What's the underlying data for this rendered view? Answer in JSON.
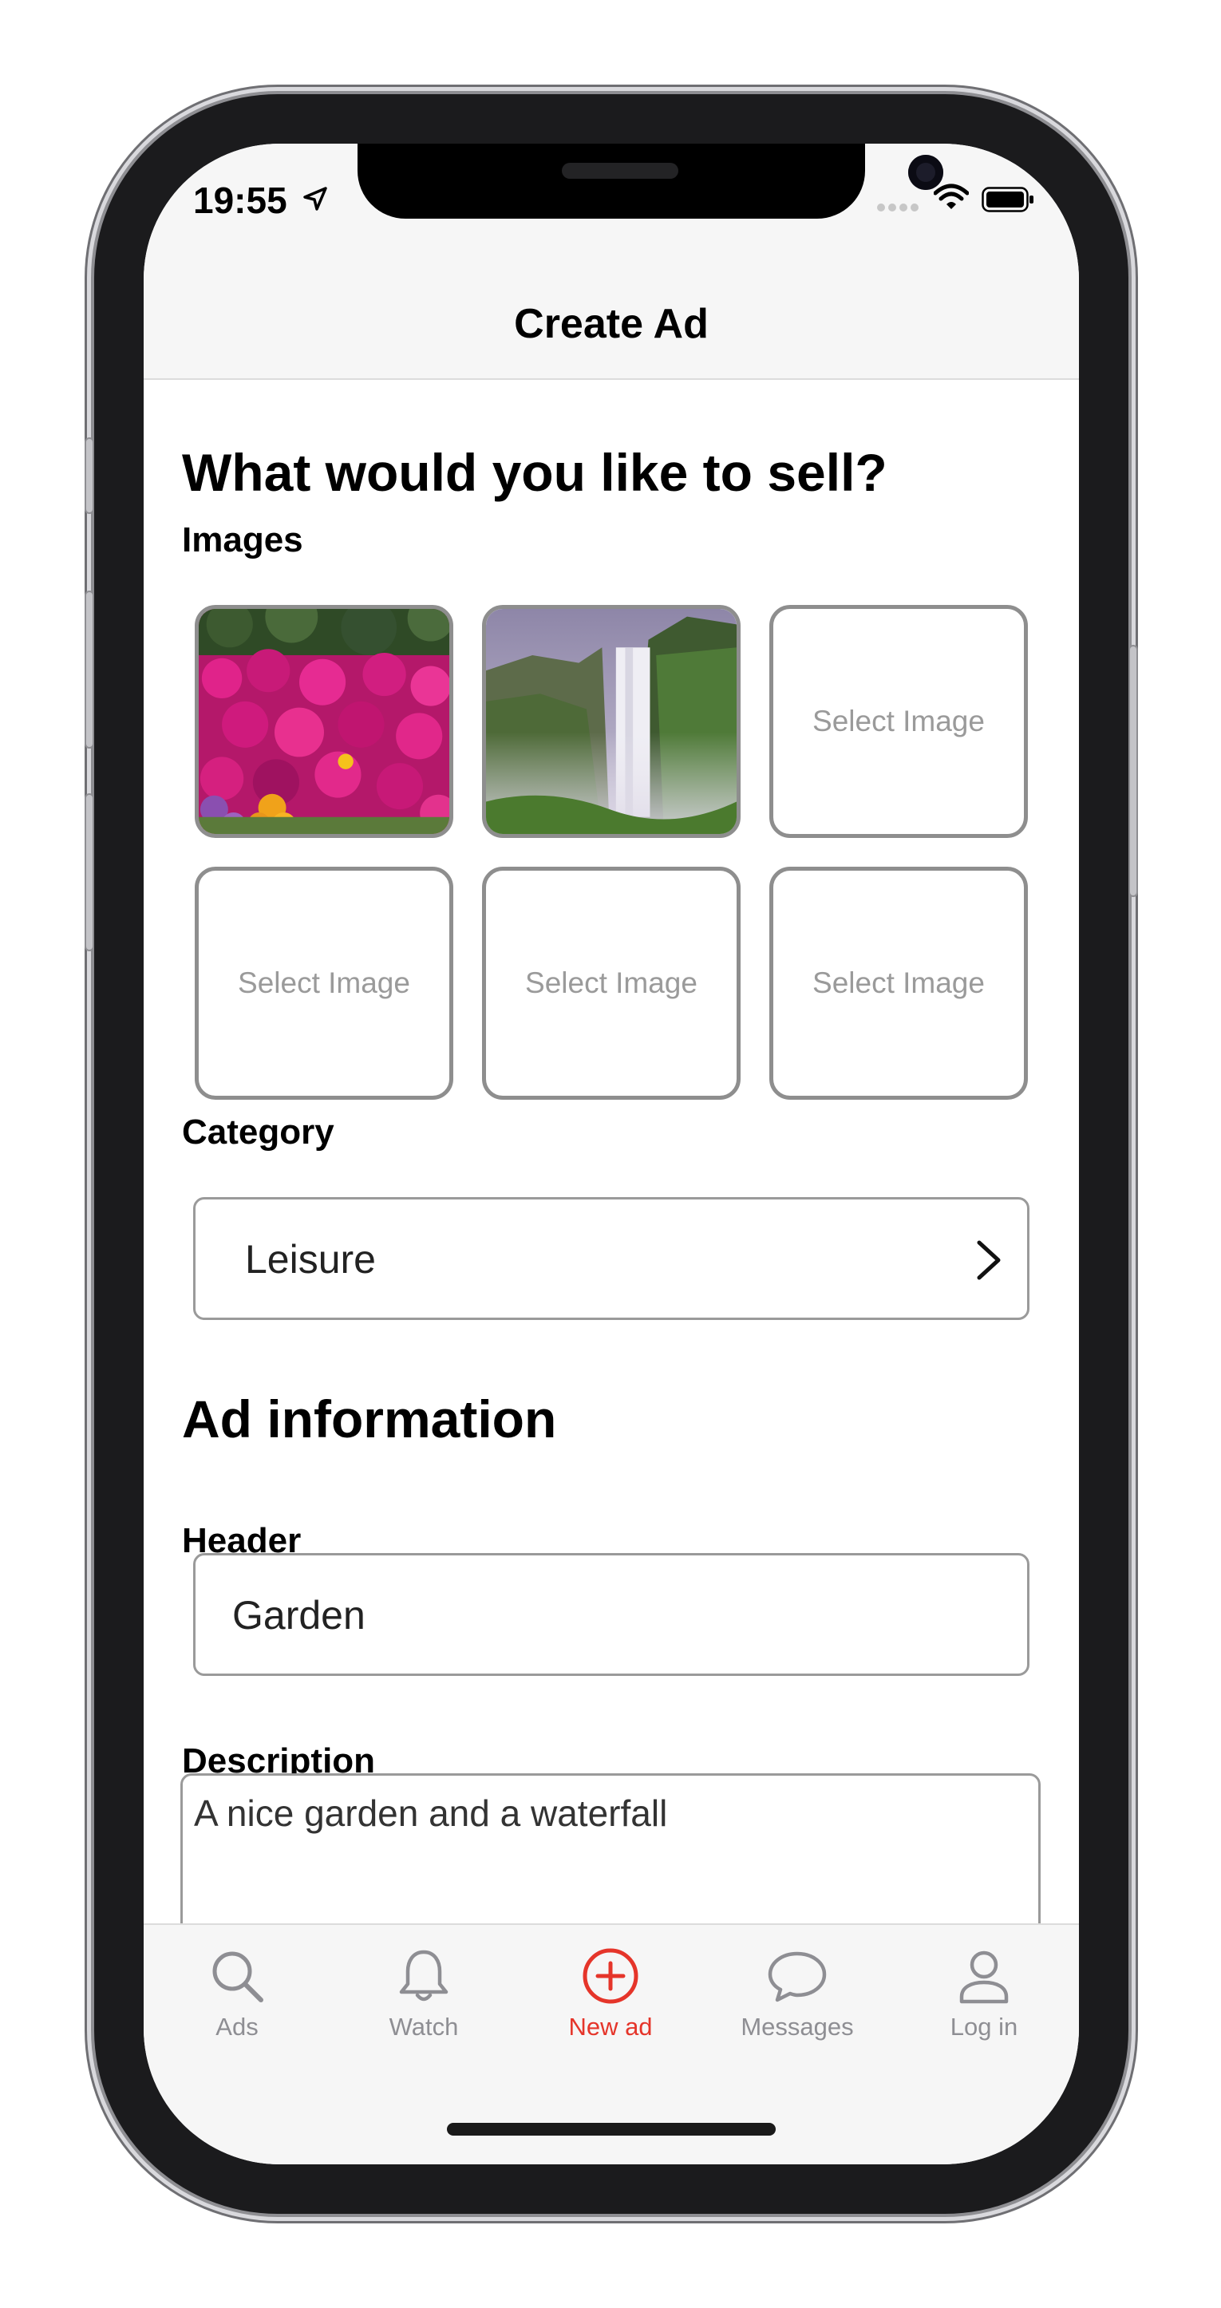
{
  "status_bar": {
    "time": "19:55"
  },
  "nav": {
    "title": "Create Ad"
  },
  "form": {
    "heading": "What would you like to sell?",
    "images_label": "Images",
    "select_image_label": "Select Image",
    "category_label": "Category",
    "category_value": "Leisure",
    "ad_info_heading": "Ad information",
    "header_label": "Header",
    "header_value": "Garden",
    "description_label": "Description",
    "description_value": "A nice garden and a waterfall"
  },
  "tabs": [
    {
      "label": "Ads",
      "icon": "search-icon"
    },
    {
      "label": "Watch",
      "icon": "bell-icon"
    },
    {
      "label": "New ad",
      "icon": "plus-circle-icon",
      "active": true
    },
    {
      "label": "Messages",
      "icon": "chat-bubble-icon"
    },
    {
      "label": "Log in",
      "icon": "person-icon"
    }
  ],
  "colors": {
    "accent": "#e5352a",
    "inactive_tab": "#8e8e93",
    "border": "#9a9a9a"
  }
}
